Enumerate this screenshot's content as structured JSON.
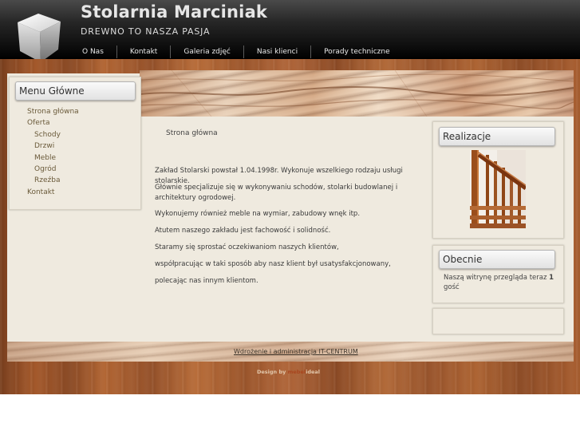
{
  "header": {
    "title": "Stolarnia Marciniak",
    "tagline": "DREWNO TO NASZA PASJA"
  },
  "topnav": [
    {
      "label": "O Nas"
    },
    {
      "label": "Kontakt"
    },
    {
      "label": "Galeria zdjęć"
    },
    {
      "label": "Nasi klienci"
    },
    {
      "label": "Porady techniczne"
    }
  ],
  "sidebar": {
    "title": "Menu Główne",
    "items": [
      {
        "label": "Strona główna",
        "level": 1
      },
      {
        "label": "Oferta",
        "level": 1
      },
      {
        "label": "Schody",
        "level": 2
      },
      {
        "label": "Drzwi",
        "level": 2
      },
      {
        "label": "Meble",
        "level": 2
      },
      {
        "label": "Ogród",
        "level": 2
      },
      {
        "label": "Rzeźba",
        "level": 2
      },
      {
        "label": "Kontakt",
        "level": 1
      }
    ]
  },
  "content": {
    "breadcrumb": "Strona główna",
    "paragraphs": [
      "Zakład Stolarski powstał 1.04.1998r. Wykonuje wszelkiego rodzaju usługi stolarskie.",
      "Głównie specjalizuje się w wykonywaniu schodów, stolarki budowlanej i architektury ogrodowej.",
      "Wykonujemy również meble na wymiar, zabudowy wnęk itp.",
      "Atutem naszego zakładu jest fachowość i solidność.",
      "Staramy się sprostać oczekiwaniom naszych klientów,",
      "współpracując w taki sposób aby nasz klient był usatysfakcjonowany,",
      " polecając nas innym klientom."
    ]
  },
  "right": {
    "realizacje_title": "Realizacje",
    "obecnie_title": "Obecnie",
    "obecnie_text_before": "Naszą witrynę przegląda teraz ",
    "obecnie_count": "1",
    "obecnie_text_after": " gość"
  },
  "footer": {
    "link": "Wdrożenie i administracja IT-CENTRUM",
    "credit_prefix": "Design by ",
    "credit_brand": "mebel",
    "credit_suffix": "ideal"
  }
}
